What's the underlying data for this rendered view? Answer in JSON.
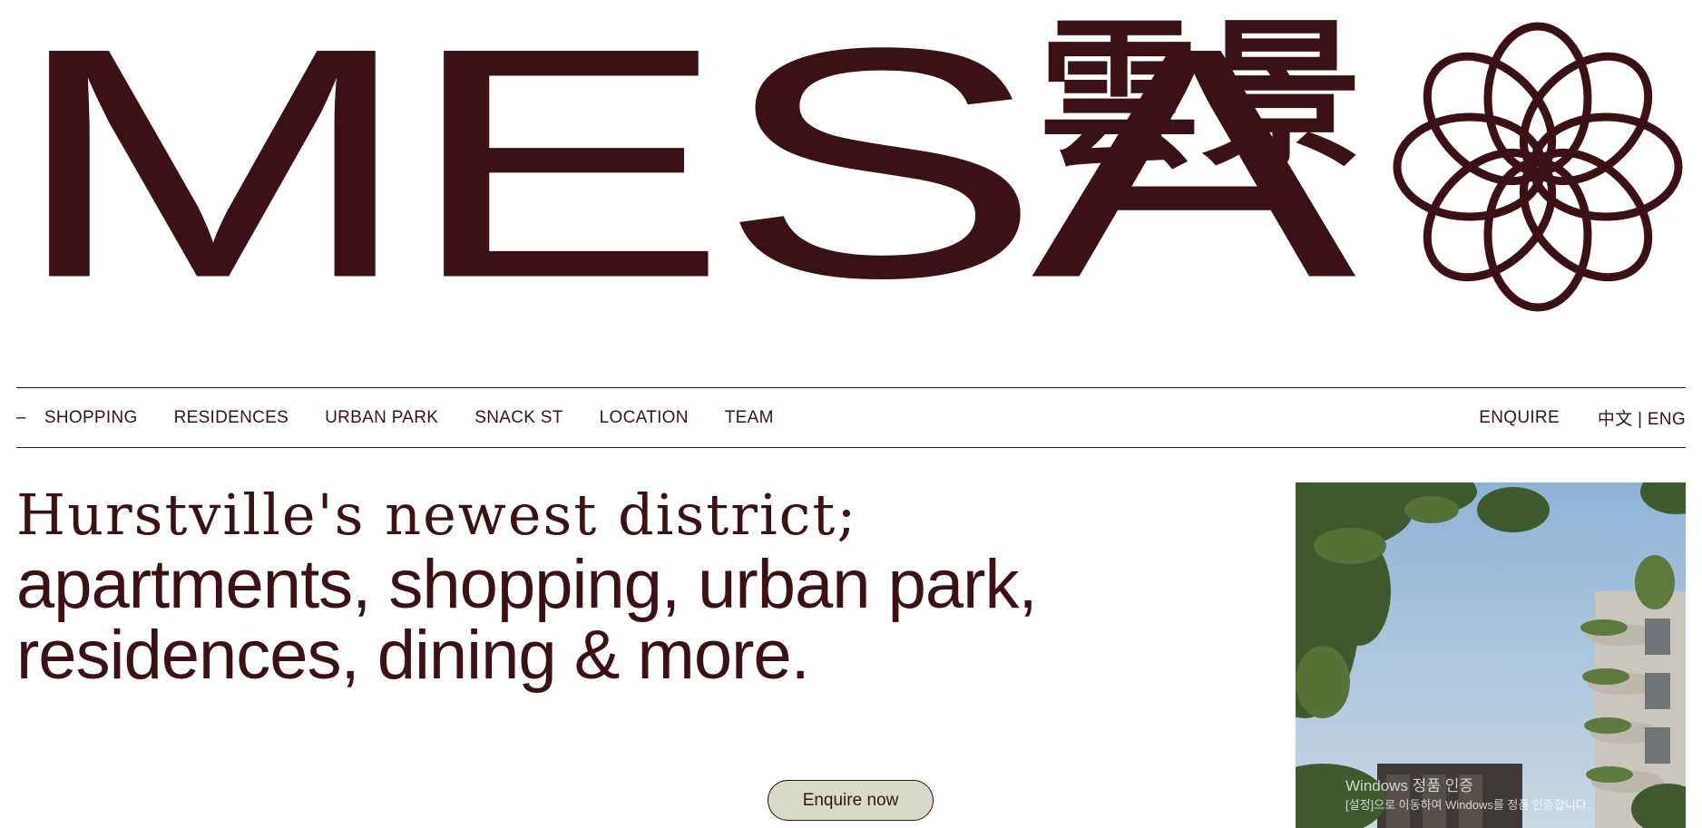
{
  "brand": {
    "logo_text": "MESA",
    "logo_cn": "雲景",
    "mark_icon": "flower-icon",
    "color": "#3b1116"
  },
  "nav": {
    "dash": "–",
    "items": [
      "SHOPPING",
      "RESIDENCES",
      "URBAN PARK",
      "SNACK ST",
      "LOCATION",
      "TEAM"
    ],
    "enquire": "ENQUIRE",
    "language": "中文 | ENG"
  },
  "hero": {
    "headline_line1": "Hurstville's newest district;",
    "headline_line2": "apartments, shopping, urban park,",
    "headline_line3": "residences, dining & more.",
    "cta_label": "Enquire now",
    "cta_color": "#d8d9c7"
  },
  "overlay": {
    "windows_notice": "Windows 정품 인증",
    "windows_notice_sub": "[설정]으로 이동하여 Windows를 정품 인증합니다."
  }
}
